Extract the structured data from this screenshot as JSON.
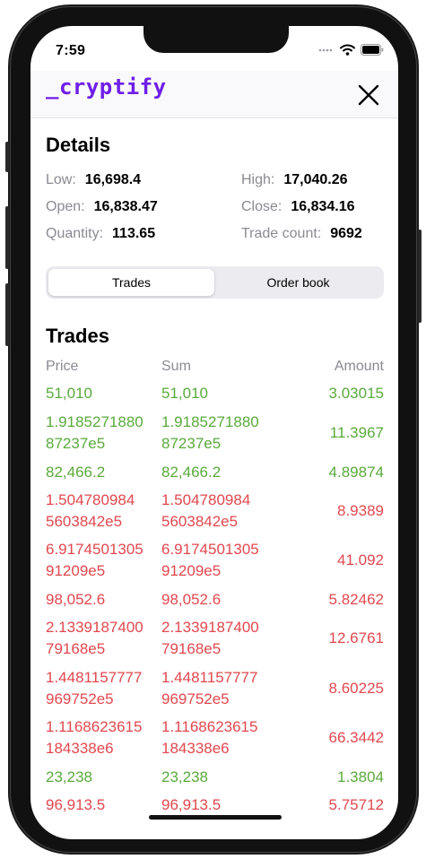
{
  "status": {
    "time": "7:59"
  },
  "header": {
    "logo": "_cryptify"
  },
  "details": {
    "title": "Details",
    "low_label": "Low:",
    "low_value": "16,698.4",
    "high_label": "High:",
    "high_value": "17,040.26",
    "open_label": "Open:",
    "open_value": "16,838.47",
    "close_label": "Close:",
    "close_value": "16,834.16",
    "quantity_label": "Quantity:",
    "quantity_value": "113.65",
    "trade_count_label": "Trade count:",
    "trade_count_value": "9692"
  },
  "tabs": {
    "trades": "Trades",
    "order_book": "Order book",
    "selected": "Trades"
  },
  "trades": {
    "title": "Trades",
    "columns": {
      "price": "Price",
      "sum": "Sum",
      "amount": "Amount"
    },
    "rows": [
      {
        "price": "51,010",
        "sum": "51,010",
        "amount": "3.03015",
        "side": "buy"
      },
      {
        "price": "1.9185271880 87237e5",
        "sum": "1.9185271880 87237e5",
        "amount": "11.3967",
        "side": "buy"
      },
      {
        "price": "82,466.2",
        "sum": "82,466.2",
        "amount": "4.89874",
        "side": "buy"
      },
      {
        "price": "1.504780984 5603842e5",
        "sum": "1.504780984 5603842e5",
        "amount": "8.9389",
        "side": "sell"
      },
      {
        "price": "6.9174501305 91209e5",
        "sum": "6.9174501305 91209e5",
        "amount": "41.092",
        "side": "sell"
      },
      {
        "price": "98,052.6",
        "sum": "98,052.6",
        "amount": "5.82462",
        "side": "sell"
      },
      {
        "price": "2.1339187400 79168e5",
        "sum": "2.1339187400 79168e5",
        "amount": "12.6761",
        "side": "sell"
      },
      {
        "price": "1.4481157777 969752e5",
        "sum": "1.4481157777 969752e5",
        "amount": "8.60225",
        "side": "sell"
      },
      {
        "price": "1.1168623615 184338e6",
        "sum": "1.1168623615 184338e6",
        "amount": "66.3442",
        "side": "sell"
      },
      {
        "price": "23,238",
        "sum": "23,238",
        "amount": "1.3804",
        "side": "buy"
      },
      {
        "price": "96,913.5",
        "sum": "96,913.5",
        "amount": "5.75712",
        "side": "sell"
      }
    ]
  },
  "colors": {
    "brand": "#6e1ee8",
    "buy": "#5aaa3c",
    "sell": "#e0484f"
  }
}
